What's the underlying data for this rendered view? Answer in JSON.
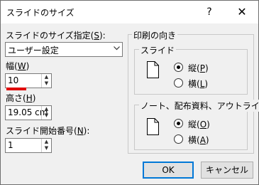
{
  "window": {
    "title": "スライドのサイズ",
    "help": "?",
    "close": "✕"
  },
  "left": {
    "size_label": "スライドのサイズ指定(",
    "size_key": "S",
    "size_suffix": "):",
    "size_value": "ユーザー設定",
    "width_label": "幅(",
    "width_key": "W",
    "width_suffix": ")",
    "width_value": "10",
    "height_label": "高さ(",
    "height_key": "H",
    "height_suffix": ")",
    "height_value": "19.05 cm",
    "start_label": "スライド開始番号(",
    "start_key": "N",
    "start_suffix": "):",
    "start_value": "1"
  },
  "orientation": {
    "title": "印刷の向き",
    "slide": {
      "title": "スライド",
      "portrait_label": "縦(",
      "portrait_key": "P",
      "portrait_suffix": ")",
      "landscape_label": "横(",
      "landscape_key": "L",
      "landscape_suffix": ")",
      "selected": "portrait"
    },
    "notes": {
      "title": "ノート、配布資料、アウトライン",
      "portrait_label": "縦(",
      "portrait_key": "O",
      "portrait_suffix": ")",
      "landscape_label": "横(",
      "landscape_key": "A",
      "landscape_suffix": ")",
      "selected": "portrait"
    }
  },
  "buttons": {
    "ok": "OK",
    "cancel": "キャンセル"
  },
  "icons": {
    "select_arrow": "chevron-down-icon",
    "spin_up": "spin-up-icon",
    "spin_down": "spin-down-icon"
  }
}
